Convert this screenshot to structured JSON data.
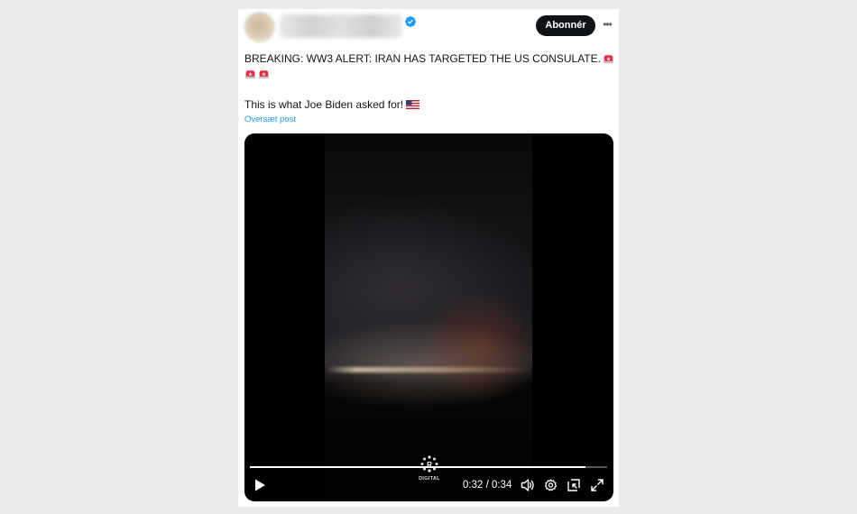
{
  "header": {
    "subscribe_label": "Abonnér",
    "more_icon": "more-horizontal-icon",
    "verified_icon": "verified-badge-icon",
    "verified_color": "#1d9bf0"
  },
  "tweet": {
    "line1": "BREAKING: WW3 ALERT: IRAN HAS TARGETED THE US CONSULATE.",
    "line2": "This is what Joe Biden asked for!",
    "emoji_icons": [
      "police-siren-icon",
      "police-siren-icon",
      "police-siren-icon",
      "us-flag-icon"
    ],
    "translate_label": "Oversæt post",
    "link_color": "#1d9bf0"
  },
  "video": {
    "progress": 0.94,
    "time_label": "0:32 / 0:34",
    "brand_text": "DIGITAL",
    "controls": [
      "play-icon",
      "volume-icon",
      "settings-icon",
      "picture-in-picture-icon",
      "fullscreen-icon"
    ]
  }
}
